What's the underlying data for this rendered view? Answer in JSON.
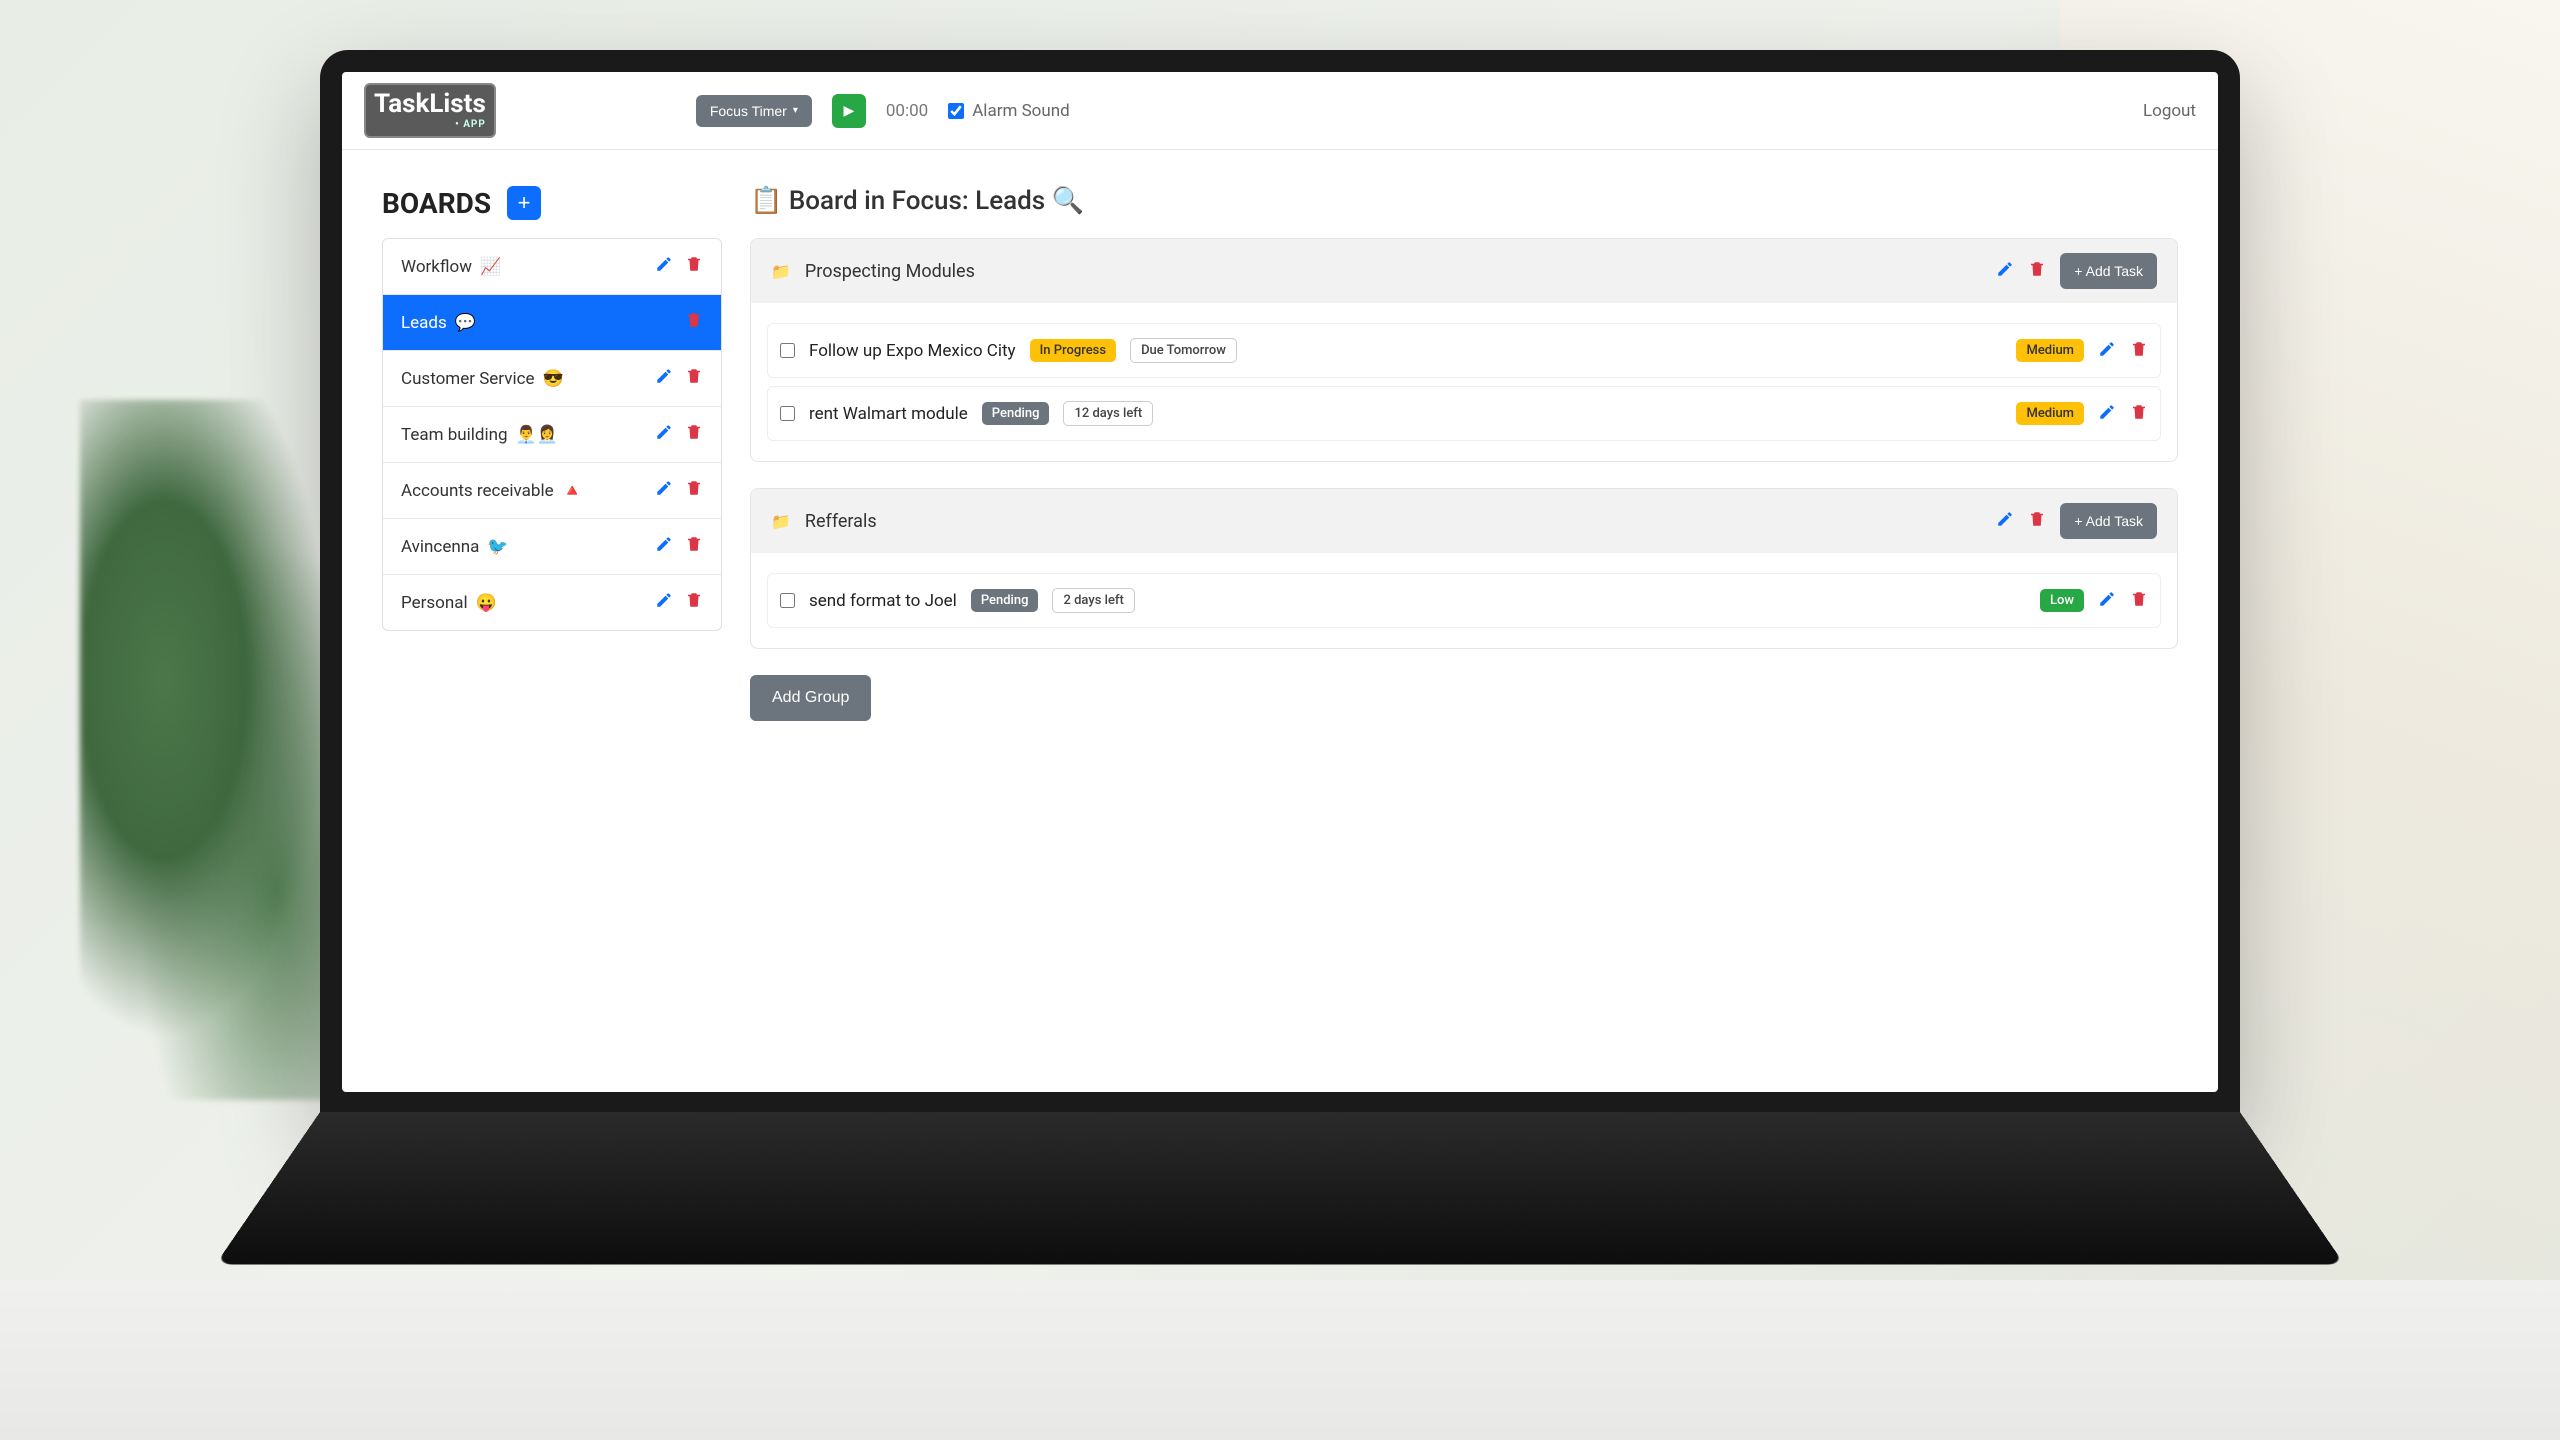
{
  "app": {
    "logo_text": "TaskLists",
    "logo_sub": "• APP"
  },
  "topbar": {
    "focus_timer": "Focus Timer",
    "timer": "00:00",
    "alarm_label": "Alarm Sound",
    "alarm_checked": true,
    "logout": "Logout"
  },
  "sidebar": {
    "heading": "BOARDS",
    "items": [
      {
        "name": "Workflow",
        "emoji": "📈",
        "active": false
      },
      {
        "name": "Leads",
        "emoji": "💬",
        "active": true
      },
      {
        "name": "Customer Service",
        "emoji": "😎",
        "active": false
      },
      {
        "name": "Team building",
        "emoji": "👨‍💼👩‍💼",
        "active": false
      },
      {
        "name": "Accounts receivable",
        "emoji": "🔺",
        "active": false
      },
      {
        "name": "Avincenna",
        "emoji": "🐦",
        "active": false
      },
      {
        "name": "Personal",
        "emoji": "😛",
        "active": false
      }
    ]
  },
  "main": {
    "title": "📋 Board in Focus: Leads 🔍",
    "groups": [
      {
        "icon": "📁",
        "title": "Prospecting Modules",
        "add_task": "+ Add Task",
        "tasks": [
          {
            "name": "Follow up Expo Mexico City",
            "status": "In Progress",
            "status_class": "b-inprogress",
            "due": "Due Tomorrow",
            "priority": "Medium",
            "priority_class": "b-medium"
          },
          {
            "name": "rent Walmart module",
            "status": "Pending",
            "status_class": "b-pending",
            "due": "12 days left",
            "priority": "Medium",
            "priority_class": "b-medium"
          }
        ]
      },
      {
        "icon": "📁",
        "title": "Refferals",
        "add_task": "+ Add Task",
        "tasks": [
          {
            "name": "send format to Joel",
            "status": "Pending",
            "status_class": "b-pending",
            "due": "2 days left",
            "priority": "Low",
            "priority_class": "b-low"
          }
        ]
      }
    ],
    "add_group": "Add Group"
  }
}
